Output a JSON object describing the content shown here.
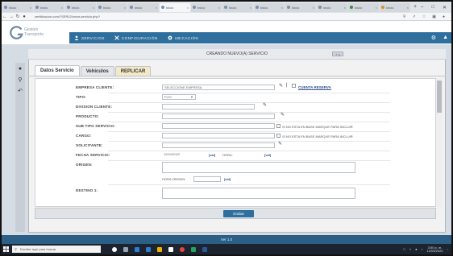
{
  "browser": {
    "tabs": [
      {
        "label": "Inicio",
        "active": false
      },
      {
        "label": "Inicio",
        "active": false
      },
      {
        "label": "Inicio",
        "active": false
      },
      {
        "label": "Inicio",
        "active": false
      },
      {
        "label": "Inicio",
        "active": false
      },
      {
        "label": "Inicio",
        "active": true
      },
      {
        "label": "Inicio",
        "active": false
      },
      {
        "label": "Inicio",
        "active": false
      },
      {
        "label": "Inicio",
        "active": false
      },
      {
        "label": "Inicio",
        "active": false
      },
      {
        "label": "Inicio",
        "active": false
      },
      {
        "label": "Inicio",
        "active": false
      },
      {
        "label": "Inicio",
        "active": false
      }
    ],
    "new_tab": "+",
    "url": "certificacion.com/?SER02/crear-servicio.php?"
  },
  "app": {
    "logo_line1": "Gestión",
    "logo_line2": "Transporte",
    "nav": [
      {
        "label": "SERVICIOS",
        "icon": "user-icon"
      },
      {
        "label": "CONFIGURACIÓN",
        "icon": "wrench-icon"
      },
      {
        "label": "UBICACIÓN",
        "icon": "location-icon"
      }
    ],
    "window_title": "CREANDO NUEVO(A) SERVICIO",
    "window_ctl": "+ x",
    "tabs": [
      "Datos Servicio",
      "Vehiculos",
      "REPLICAR"
    ]
  },
  "form": {
    "empresa_label": "EMPRESA CLIENTE:",
    "empresa_value": "SELECCIONE EMPRESA",
    "cuenta_link": "CUENTA RESERVA",
    "tipo_label": "TIPO:",
    "tipo_value": "FIJO",
    "division_label": "DIVISION CLIENTE:",
    "producto_label": "PRODUCTO:",
    "subtipo_label": "SUB TIPO SERVICIO:",
    "subtipo_note": "SI NO ESTA EN BASE MARQUE PARA INCLUIR",
    "cargo_label": "CARGO:",
    "cargo_note": "SI NO ESTA EN BASE MARQUE PARA INCLUIR",
    "solicitante_label": "SOLICITANTE:",
    "fecha_label": "FECHA SERVICIO:",
    "fecha_value": "12/04/2022",
    "cal_label": "[cal]",
    "hora_label": "HORA:",
    "cal2_label": "[cal]",
    "origen_label": "ORIGEN:",
    "hora_origen_label": "HORA ORIGEN:",
    "cal3_label": "[cal]",
    "destino_label": "DESTINO 1:"
  },
  "save_label": "Grabar",
  "version": "Ver 1.0",
  "taskbar": {
    "search_placeholder": "Escribe aquí para buscar",
    "time": "3:50 p. m.",
    "date": "12/04/2022"
  },
  "colors": {
    "nav_blue": "#2e6f9e",
    "version_blue": "#2b5f86",
    "taskbar": "#1d2430"
  }
}
